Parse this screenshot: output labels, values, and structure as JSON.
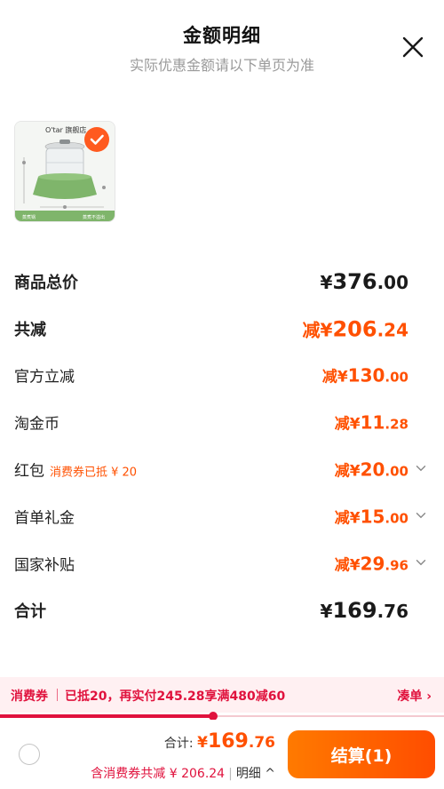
{
  "header": {
    "title": "金额明细",
    "subtitle": "实际优惠金额请以下单页为准"
  },
  "product": {
    "brand": "O'tar",
    "brand_suffix": "旗舰店",
    "caption_left": "蒸煮锅",
    "caption_right": "蒸煮不溢出"
  },
  "rows": {
    "subtotal": {
      "label": "商品总价",
      "prefix": "",
      "currency": "¥",
      "int": "376",
      "dec": ".00"
    },
    "discount": {
      "label": "共减",
      "prefix": "减",
      "currency": "¥",
      "int": "206",
      "dec": ".24"
    },
    "official": {
      "label": "官方立减",
      "prefix": "减",
      "currency": "¥",
      "int": "130",
      "dec": ".00"
    },
    "coins": {
      "label": "淘金币",
      "prefix": "减",
      "currency": "¥",
      "int": "11",
      "dec": ".28"
    },
    "redpacket": {
      "label": "红包",
      "tag": "消费券已抵 ¥ 20",
      "prefix": "减",
      "currency": "¥",
      "int": "20",
      "dec": ".00"
    },
    "firstorder": {
      "label": "首单礼金",
      "prefix": "减",
      "currency": "¥",
      "int": "15",
      "dec": ".00"
    },
    "subsidy": {
      "label": "国家补贴",
      "prefix": "减",
      "currency": "¥",
      "int": "29",
      "dec": ".96"
    },
    "total": {
      "label": "合计",
      "prefix": "",
      "currency": "¥",
      "int": "169",
      "dec": ".76"
    }
  },
  "coupon_bar": {
    "name": "消费券",
    "message": "已抵20，再实付245.28享满480减60",
    "link": "凑单 ›",
    "progress": 0.48
  },
  "footer": {
    "total_label": "合计: ",
    "currency": "¥",
    "total_int": "169",
    "total_dec": ".76",
    "summary": "含消费券共减 ¥ 206.24",
    "detail": "明细 ^",
    "checkout": "结算(1)"
  },
  "colors": {
    "accent": "#ff5000",
    "coupon": "#e0123d",
    "button_from": "#ff7a00",
    "button_to": "#ff4d00"
  }
}
